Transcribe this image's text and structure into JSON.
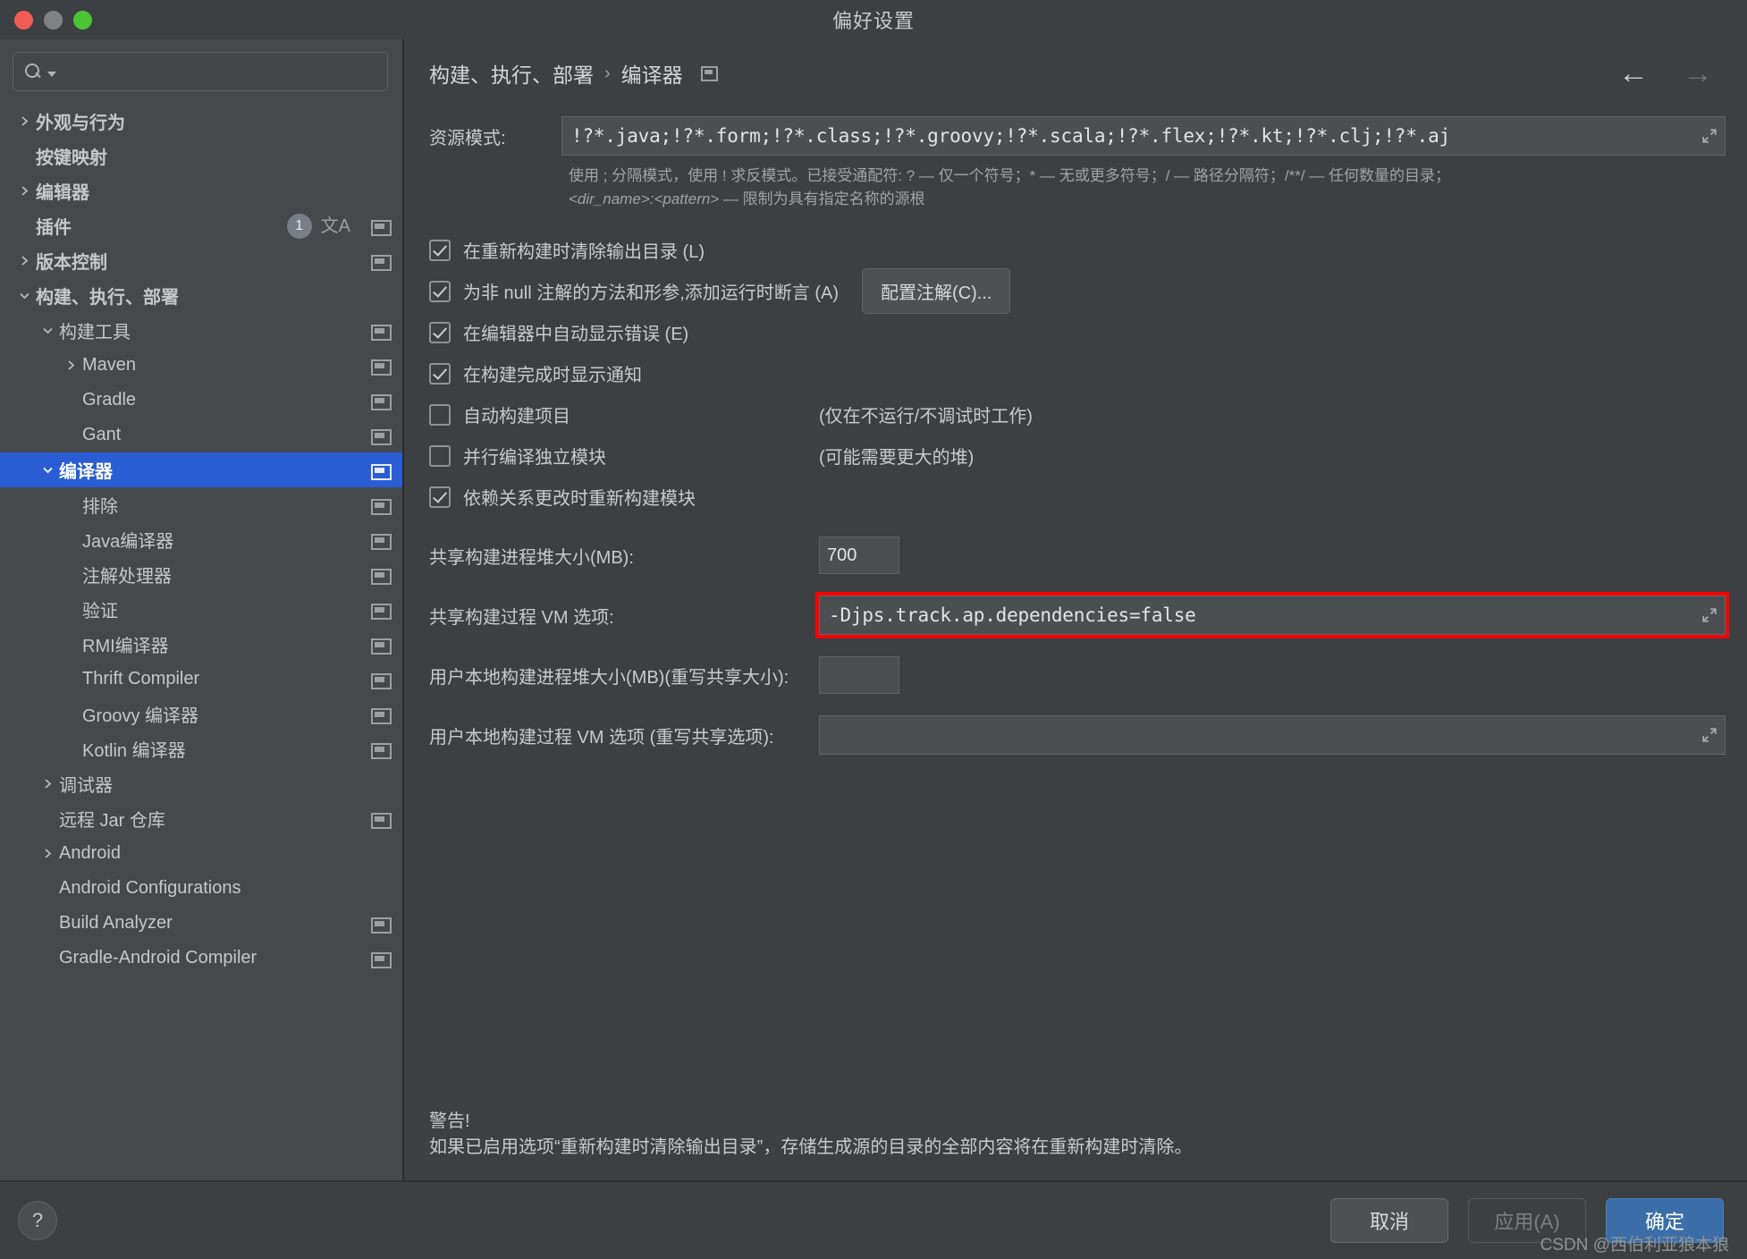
{
  "window": {
    "title": "偏好设置",
    "traffic_lights": [
      "close-button",
      "minimize-button",
      "zoom-button"
    ]
  },
  "sidebar": {
    "search": {
      "value": "",
      "placeholder": ""
    },
    "items": [
      {
        "label": "外观与行为",
        "indent": 0,
        "arrow": "right",
        "bold": true,
        "icon": "",
        "badge": "",
        "selected": false
      },
      {
        "label": "按键映射",
        "indent": 0,
        "arrow": "none",
        "bold": true,
        "icon": "",
        "badge": "",
        "selected": false
      },
      {
        "label": "编辑器",
        "indent": 0,
        "arrow": "right",
        "bold": true,
        "icon": "",
        "badge": "",
        "selected": false
      },
      {
        "label": "插件",
        "indent": 0,
        "arrow": "none",
        "bold": true,
        "icon": "copy",
        "badge": "1",
        "lang": "文A",
        "selected": false
      },
      {
        "label": "版本控制",
        "indent": 0,
        "arrow": "right",
        "bold": true,
        "icon": "copy",
        "badge": "",
        "selected": false
      },
      {
        "label": "构建、执行、部署",
        "indent": 0,
        "arrow": "down",
        "bold": true,
        "icon": "",
        "badge": "",
        "selected": false
      },
      {
        "label": "构建工具",
        "indent": 1,
        "arrow": "down",
        "bold": false,
        "icon": "copy",
        "badge": "",
        "selected": false
      },
      {
        "label": "Maven",
        "indent": 2,
        "arrow": "right",
        "bold": false,
        "icon": "copy",
        "badge": "",
        "selected": false
      },
      {
        "label": "Gradle",
        "indent": 2,
        "arrow": "none",
        "bold": false,
        "icon": "copy",
        "badge": "",
        "selected": false
      },
      {
        "label": "Gant",
        "indent": 2,
        "arrow": "none",
        "bold": false,
        "icon": "copy",
        "badge": "",
        "selected": false
      },
      {
        "label": "编译器",
        "indent": 1,
        "arrow": "down",
        "bold": true,
        "icon": "copy",
        "badge": "",
        "selected": true
      },
      {
        "label": "排除",
        "indent": 2,
        "arrow": "none",
        "bold": false,
        "icon": "copy",
        "badge": "",
        "selected": false
      },
      {
        "label": "Java编译器",
        "indent": 2,
        "arrow": "none",
        "bold": false,
        "icon": "copy",
        "badge": "",
        "selected": false
      },
      {
        "label": "注解处理器",
        "indent": 2,
        "arrow": "none",
        "bold": false,
        "icon": "copy",
        "badge": "",
        "selected": false
      },
      {
        "label": "验证",
        "indent": 2,
        "arrow": "none",
        "bold": false,
        "icon": "copy",
        "badge": "",
        "selected": false
      },
      {
        "label": "RMI编译器",
        "indent": 2,
        "arrow": "none",
        "bold": false,
        "icon": "copy",
        "badge": "",
        "selected": false
      },
      {
        "label": "Thrift Compiler",
        "indent": 2,
        "arrow": "none",
        "bold": false,
        "icon": "copy",
        "badge": "",
        "selected": false
      },
      {
        "label": "Groovy 编译器",
        "indent": 2,
        "arrow": "none",
        "bold": false,
        "icon": "copy",
        "badge": "",
        "selected": false
      },
      {
        "label": "Kotlin 编译器",
        "indent": 2,
        "arrow": "none",
        "bold": false,
        "icon": "copy",
        "badge": "",
        "selected": false
      },
      {
        "label": "调试器",
        "indent": 1,
        "arrow": "right",
        "bold": false,
        "icon": "",
        "badge": "",
        "selected": false
      },
      {
        "label": "远程 Jar 仓库",
        "indent": 1,
        "arrow": "none",
        "bold": false,
        "icon": "copy",
        "badge": "",
        "selected": false
      },
      {
        "label": "Android",
        "indent": 1,
        "arrow": "right",
        "bold": false,
        "icon": "",
        "badge": "",
        "selected": false
      },
      {
        "label": "Android Configurations",
        "indent": 1,
        "arrow": "none",
        "bold": false,
        "icon": "",
        "badge": "",
        "selected": false
      },
      {
        "label": "Build Analyzer",
        "indent": 1,
        "arrow": "none",
        "bold": false,
        "icon": "copy",
        "badge": "",
        "selected": false
      },
      {
        "label": "Gradle-Android Compiler",
        "indent": 1,
        "arrow": "none",
        "bold": false,
        "icon": "copy",
        "badge": "",
        "selected": false
      }
    ]
  },
  "main": {
    "breadcrumb": {
      "parent": "构建、执行、部署",
      "separator": "›",
      "current": "编译器"
    },
    "nav": {
      "back": "←",
      "forward": "→"
    },
    "resource_pattern": {
      "label": "资源模式:",
      "value": "!?*.java;!?*.form;!?*.class;!?*.groovy;!?*.scala;!?*.flex;!?*.kt;!?*.clj;!?*.aj"
    },
    "hint_line1": "使用 ; 分隔模式，使用 ! 求反模式。已接受通配符: ? — 仅一个符号；* — 无或更多符号；/ — 路径分隔符；/**/ — 任何数量的目录；",
    "hint_line2_italic": "<dir_name>:<pattern>",
    "hint_line2_rest": " — 限制为具有指定名称的源根",
    "checkboxes": [
      {
        "label": "在重新构建时清除输出目录 (L)",
        "checked": true,
        "note": "",
        "button": ""
      },
      {
        "label": "为非 null 注解的方法和形参,添加运行时断言 (A)",
        "checked": true,
        "note": "",
        "button": "配置注解(C)..."
      },
      {
        "label": "在编辑器中自动显示错误 (E)",
        "checked": true,
        "note": "",
        "button": ""
      },
      {
        "label": "在构建完成时显示通知",
        "checked": true,
        "note": "",
        "button": ""
      },
      {
        "label": "自动构建项目",
        "checked": false,
        "note": "(仅在不运行/不调试时工作)",
        "button": ""
      },
      {
        "label": "并行编译独立模块",
        "checked": false,
        "note": "(可能需要更大的堆)",
        "button": ""
      },
      {
        "label": "依赖关系更改时重新构建模块",
        "checked": true,
        "note": "",
        "button": ""
      }
    ],
    "fields": [
      {
        "label": "共享构建进程堆大小(MB):",
        "value": "700",
        "kind": "small",
        "highlight": false
      },
      {
        "label": "共享构建过程 VM 选项:",
        "value": "-Djps.track.ap.dependencies=false",
        "kind": "wide",
        "highlight": true
      },
      {
        "label": "用户本地构建进程堆大小(MB)(重写共享大小):",
        "value": "",
        "kind": "small",
        "highlight": false
      },
      {
        "label": "用户本地构建过程 VM 选项 (重写共享选项):",
        "value": "",
        "kind": "wide",
        "highlight": false
      }
    ],
    "warning_title": "警告!",
    "warning_body": "如果已启用选项“重新构建时清除输出目录”，存储生成源的目录的全部内容将在重新构建时清除。"
  },
  "footer": {
    "help_label": "?",
    "cancel_label": "取消",
    "apply_label": "应用(A)",
    "ok_label": "确定",
    "watermark": "CSDN @西伯利亚狼本狼"
  },
  "colors": {
    "selection_blue": "#2a5dd4",
    "primary_button": "#3b6ea8",
    "highlight_red": "#ff0000",
    "window_bg": "#3c4043",
    "sidebar_bg": "#45494c"
  }
}
